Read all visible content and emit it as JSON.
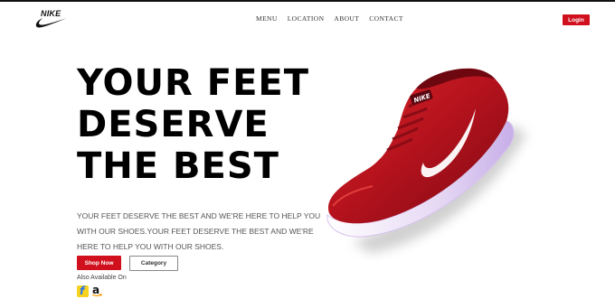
{
  "header": {
    "logo_text": "NIKE",
    "nav": [
      "MENU",
      "LOCATION",
      "ABOUT",
      "CONTACT"
    ],
    "login_label": "Login"
  },
  "hero": {
    "headline": [
      "YOUR FEET",
      "DESERVE",
      "THE BEST"
    ],
    "description": "YOUR FEET DESERVE THE BEST AND WE'RE HERE TO HELP YOU WITH OUR SHOES.YOUR FEET DESERVE THE BEST AND WE'RE HERE TO HELP YOU WITH OUR SHOES.",
    "shop_label": "Shop Now",
    "category_label": "Category",
    "available_label": "Also Available On",
    "stores": [
      "flipkart-icon",
      "amazon-icon"
    ],
    "shoe_logo_text": "NIKE"
  },
  "colors": {
    "accent": "#d0101d",
    "shoe_body": "#b3121d",
    "sole": "#d9c6f0"
  }
}
